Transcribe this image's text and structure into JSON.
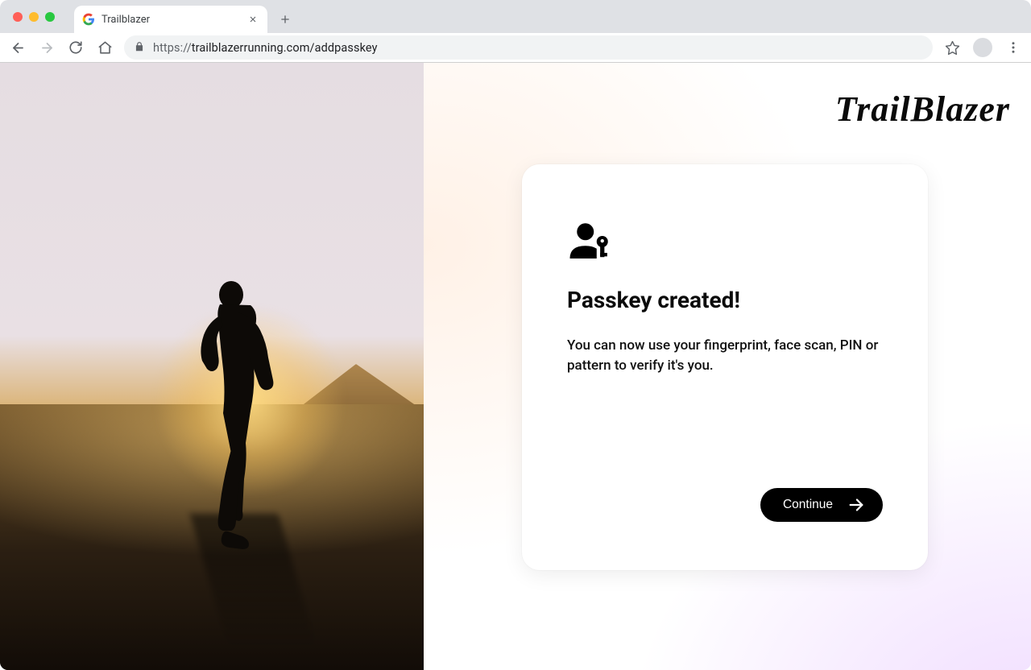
{
  "browser": {
    "tab_title": "Trailblazer",
    "url_display": "https://trailblazerrunning.com/addpasskey",
    "url_protocol": "https://",
    "url_rest": "trailblazerrunning.com/addpasskey"
  },
  "page": {
    "brand": "TrailBlazer",
    "card": {
      "heading": "Passkey created!",
      "body": "You can now use your fingerprint, face scan, PIN or pattern to verify it's you.",
      "continue_label": "Continue"
    }
  }
}
